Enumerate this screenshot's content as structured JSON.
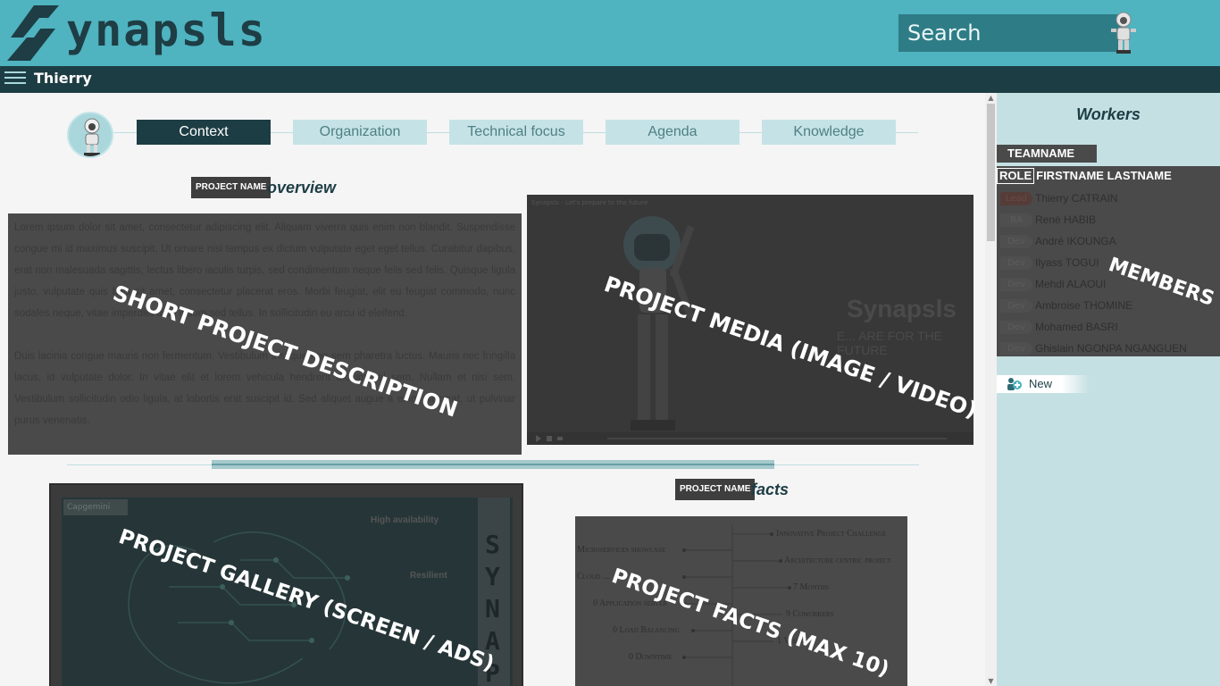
{
  "header": {
    "logo_text": "ynapsls",
    "search_placeholder": "Search"
  },
  "userbar": {
    "username": "Thierry"
  },
  "tabs": [
    {
      "label": "Context",
      "active": true
    },
    {
      "label": "Organization",
      "active": false
    },
    {
      "label": "Technical focus",
      "active": false
    },
    {
      "label": "Agenda",
      "active": false
    },
    {
      "label": "Knowledge",
      "active": false
    }
  ],
  "overview": {
    "badge": "PROJECT NAME",
    "title_suffix": "overview",
    "description_paragraphs": [
      "Lorem ipsum dolor sit amet, consectetur adipiscing elit. Aliquam viverra quis enim non blandit. Suspendisse congue mi id maximus suscipit. Ut ornare nisl tempus ex dictum vulputate eget eget tellus. Curabitur dapibus, erat non malesuada sagittis, lectus libero iaculis turpis, sed condimentum neque felis sed felis. Quisque ligula justo, vulputate quis felis sit amet, consectetur placerat eros. Morbi feugiat, elit eu feugiat commodo, nunc sodales neque, vitae imperdiet arcu ipsum sed tellus. In sollicitudin eu arcu id eleifend.",
      "Duis lacinia congue mauris non fermentum. Vestibulum tristique non sem pharetra luctus. Mauris nec fringilla lacus, id vulputate dolor. In vitae elit et lorem vehicula hendrerit dictum vel sem. Nullam et nisi sem. Vestibulum sollicitudin odio ligula, at lobortis erat suscipit id. Sed aliquet augue a enim placerat, ut pulvinar purus venenatis."
    ],
    "description_overlay": "SHORT PROJECT DESCRIPTION",
    "media_overlay": "PROJECT MEDIA (IMAGE / VIDEO)",
    "media_title": "Synapsls - Let's prepare to the future",
    "media_brand": "Synapsls",
    "media_tagline": "E... ARE FOR THE FUTURE"
  },
  "gallery": {
    "overlay": "PROJECT GALLERY (SCREEN / ADS)",
    "brand": "Capgemini",
    "hint1": "High availability",
    "hint2": "Resilient",
    "side_letters": [
      "S",
      "Y",
      "N",
      "A",
      "P"
    ]
  },
  "facts": {
    "badge": "PROJECT NAME",
    "title_suffix": "facts",
    "overlay": "PROJECT FACTS (MAX 10)",
    "left": [
      "Microservices showcase",
      "Cloud ...",
      "0 Application server",
      "0 Load Balancing",
      "0 Downtime"
    ],
    "right": [
      "Innovative Project Challenge",
      "Architecture centric project",
      "7 Months",
      "9 Coworkers",
      "1 Vision"
    ]
  },
  "workers": {
    "title": "Workers",
    "team_badge": "TEAMNAME",
    "head_role": "ROLE",
    "head_name": "FIRSTNAME LASTNAME",
    "members_overlay": "MEMBERS",
    "members": [
      {
        "role": "Lead",
        "name": "Thierry CATRAIN"
      },
      {
        "role": "BA",
        "name": "René HABIB"
      },
      {
        "role": "Dev",
        "name": "André IKOUNGA"
      },
      {
        "role": "Dev",
        "name": "Ilyass TOGUI"
      },
      {
        "role": "Dev",
        "name": "Mehdi ALAOUI"
      },
      {
        "role": "Dev",
        "name": "Ambroise THOMINE"
      },
      {
        "role": "Dev",
        "name": "Mohamed BASRI"
      },
      {
        "role": "Dev",
        "name": "Ghislain NGONPA NGANGUEN"
      }
    ],
    "new_label": "New"
  }
}
